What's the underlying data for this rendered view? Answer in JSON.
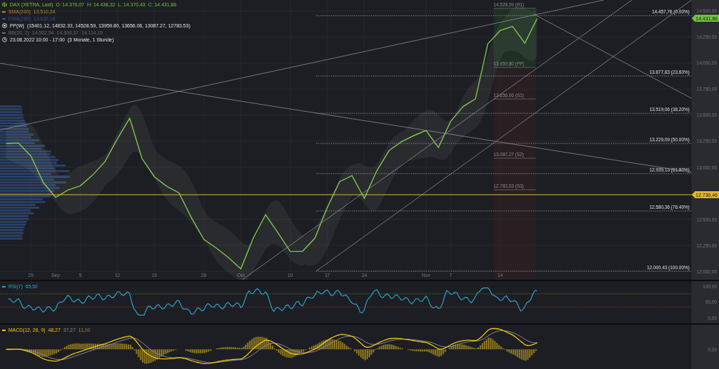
{
  "legend": {
    "title": "DAX (XETRA, Last)",
    "ohlc": [
      {
        "label": "O:",
        "value": "14.376,07"
      },
      {
        "label": "H:",
        "value": "14.436,32"
      },
      {
        "label": "L:",
        "value": "14.370,43"
      },
      {
        "label": "C:",
        "value": "14.431,86"
      }
    ],
    "indicators": [
      {
        "kind": "line",
        "label": "SMA(200)",
        "values": [
          "13.510,34"
        ],
        "color": "#b8862a"
      },
      {
        "kind": "line",
        "label": "EMA(200)",
        "values": [
          "13.632,18"
        ],
        "color": "#2a5590"
      },
      {
        "kind": "pivot",
        "label": "PP(W)",
        "values": [
          "(15401.12, 14832.33, 14528.59, 13959.80, 13656.06, 13087.27, 12783.53)"
        ]
      },
      {
        "kind": "line",
        "label": "BB(20, 2)",
        "values": [
          "14.502,54",
          "14.308,37",
          "14.114,19"
        ],
        "color": "#6a6b72"
      },
      {
        "kind": "clock",
        "label": "23.08.2022 10:00 - 17:00",
        "values": [
          "(3 Monate, 1 Stunde)"
        ]
      }
    ]
  },
  "price_chart": {
    "chart_data": {
      "type": "line",
      "grid": true,
      "categories": [
        null,
        null,
        "29",
        null,
        "Sep",
        null,
        "5",
        null,
        null,
        "12",
        null,
        null,
        "19",
        null,
        null,
        null,
        "26",
        null,
        null,
        "Okt",
        null,
        null,
        null,
        "10",
        null,
        null,
        "17",
        null,
        null,
        "24",
        null,
        null,
        null,
        null,
        "Nov",
        null,
        "7",
        null,
        null,
        null,
        "14",
        null,
        null,
        null,
        null,
        null,
        null,
        null,
        null,
        null,
        null,
        null,
        null,
        null,
        null,
        null
      ],
      "series": [
        {
          "color": "#7cc242",
          "values": [
            13228,
            13234,
            13108,
            12855,
            12711,
            12781,
            12822,
            12925,
            13055,
            13272,
            13471,
            13084,
            12909,
            12817,
            12754,
            12516,
            12307,
            12225,
            12132,
            12024,
            12318,
            12544,
            12371,
            12192,
            12192,
            12319,
            12613,
            12862,
            12920,
            12702,
            12964,
            13160,
            13245,
            13304,
            13354,
            13190,
            13443,
            13584,
            13658,
            14187,
            14315,
            14354,
            14193,
            14431,
            null,
            null,
            null,
            null,
            null,
            null,
            null,
            null,
            null,
            null,
            null,
            null
          ]
        }
      ],
      "ylim": [
        11919,
        14608
      ],
      "yticks": [
        {
          "value": 12000,
          "label": "12.000,00"
        },
        {
          "value": 12250,
          "label": "12.250,00"
        },
        {
          "value": 12500,
          "label": "12.500,00"
        },
        {
          "value": 13000,
          "label": "13.000,00"
        },
        {
          "value": 13250,
          "label": "13.250,00"
        },
        {
          "value": 13500,
          "label": "13.500,00"
        },
        {
          "value": 13750,
          "label": "13.750,00"
        },
        {
          "value": 14000,
          "label": "14.000,00"
        },
        {
          "value": 14250,
          "label": "14.250,00"
        },
        {
          "value": 14500,
          "label": "14.500,00"
        }
      ]
    },
    "fib_levels": [
      {
        "label": "14.457,76 (0.00%)"
      },
      {
        "label": "13.877,83 (23.60%)"
      },
      {
        "label": "13.519,06 (38.20%)"
      },
      {
        "label": "13.229,09 (50.00%)"
      },
      {
        "label": "12.939,13 (61.80%)"
      },
      {
        "label": "12.580,36 (76.40%)"
      },
      {
        "label": "12.000,43 (100.00%)"
      }
    ],
    "pivots": [
      {
        "label": "14.528,59 (R1)"
      },
      {
        "label": "13.959,80 (PP)"
      },
      {
        "label": "13.656,06 (S1)"
      },
      {
        "label": "13.087,27 (S2)"
      },
      {
        "label": "12.783,53 (S3)"
      }
    ],
    "level_line": {
      "label": "12.736,46",
      "color": "#e0b92a"
    },
    "last_price": {
      "label": "14.431,86",
      "color": "#6fc33c"
    }
  },
  "rsi": {
    "label": "RSI(7)",
    "value": "65,50",
    "axis": [
      "100,00",
      "50,00",
      "0,00"
    ]
  },
  "macd": {
    "label": "MACD(12, 26, 9)",
    "values": [
      "48,27",
      "37,27",
      "11,00"
    ],
    "axis": [
      "0,00"
    ]
  }
}
